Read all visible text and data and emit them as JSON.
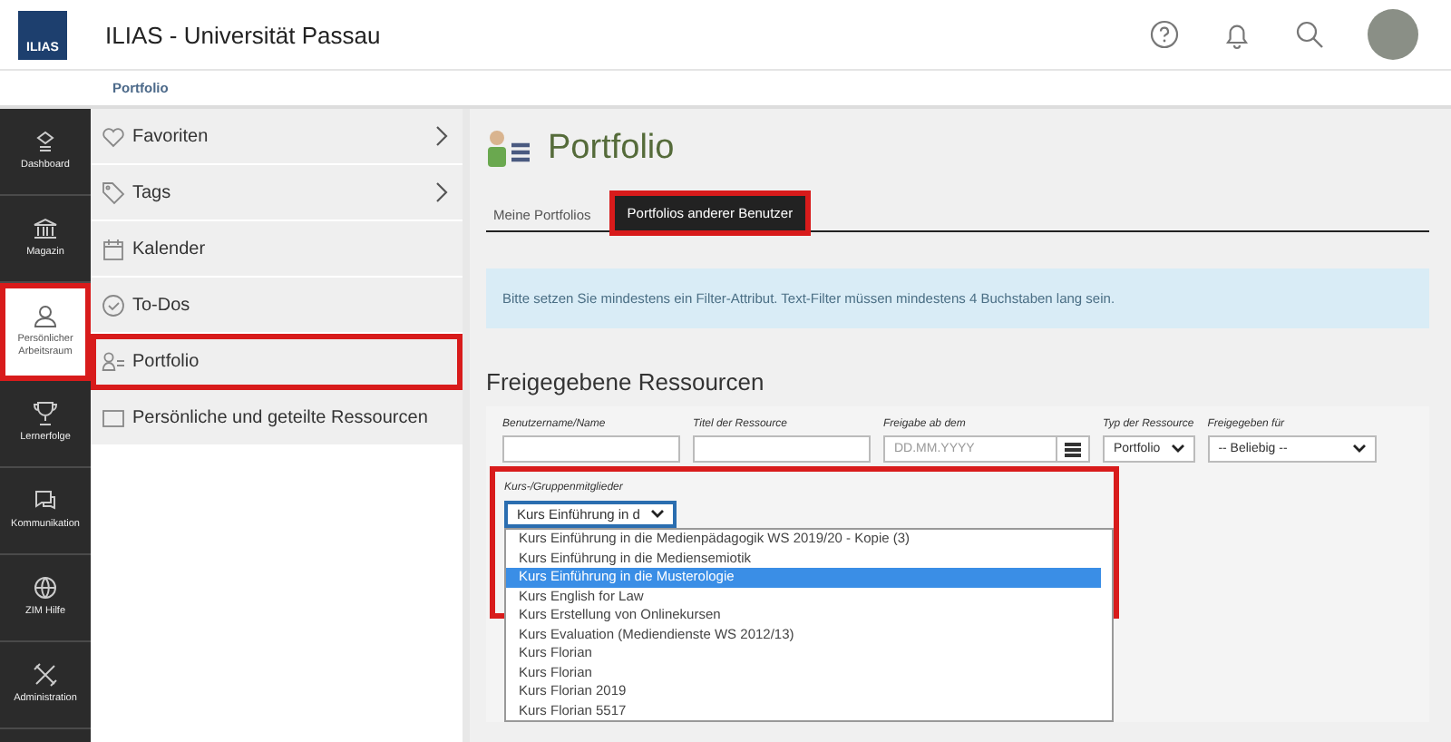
{
  "header": {
    "logo": "ILIAS",
    "title": "ILIAS - Universität Passau"
  },
  "breadcrumb": "Portfolio",
  "rail": [
    {
      "label": "Dashboard",
      "selected": false,
      "highlighted": false
    },
    {
      "label": "Magazin",
      "selected": false,
      "highlighted": false
    },
    {
      "label": "Persönlicher Arbeitsraum",
      "selected": true,
      "highlighted": true
    },
    {
      "label": "Lernerfolge",
      "selected": false,
      "highlighted": false
    },
    {
      "label": "Kommunikation",
      "selected": false,
      "highlighted": false
    },
    {
      "label": "ZIM Hilfe",
      "selected": false,
      "highlighted": false
    },
    {
      "label": "Administration",
      "selected": false,
      "highlighted": false
    }
  ],
  "sidebar": [
    {
      "label": "Favoriten",
      "has_submenu": true,
      "highlighted": false
    },
    {
      "label": "Tags",
      "has_submenu": true,
      "highlighted": false
    },
    {
      "label": "Kalender",
      "has_submenu": false,
      "highlighted": false
    },
    {
      "label": "To-Dos",
      "has_submenu": false,
      "highlighted": false
    },
    {
      "label": "Portfolio",
      "has_submenu": false,
      "highlighted": true
    },
    {
      "label": "Persönliche und geteilte Ressourcen",
      "has_submenu": false,
      "highlighted": false
    }
  ],
  "page_title": "Portfolio",
  "tabs": [
    {
      "label": "Meine Portfolios",
      "selected": false,
      "highlighted": false
    },
    {
      "label": "Portfolios anderer Benutzer",
      "selected": true,
      "highlighted": true
    }
  ],
  "info_message": "Bitte setzen Sie mindestens ein Filter-Attribut. Text-Filter müssen mindestens 4 Buchstaben lang sein.",
  "section_title": "Freigegebene Ressourcen",
  "filters": [
    {
      "label": "Benutzername/Name",
      "kind": "text"
    },
    {
      "label": "Titel der Ressource",
      "kind": "text"
    },
    {
      "label": "Freigabe ab dem",
      "kind": "date",
      "placeholder": "DD.MM.YYYY"
    },
    {
      "label": "Typ der Ressource",
      "kind": "select",
      "value": "Portfolio"
    },
    {
      "label": "Freigegeben für",
      "kind": "select",
      "value": "-- Beliebig --"
    }
  ],
  "course_filter": {
    "label": "Kurs-/Gruppenmitglieder",
    "value": "Kurs Einführung in d",
    "highlighted": true,
    "options": [
      {
        "label": "Kurs Einführung in die Medienpädagogik WS 2019/20 - Kopie (3)",
        "selected": false
      },
      {
        "label": "Kurs Einführung in die Mediensemiotik",
        "selected": false
      },
      {
        "label": "Kurs Einführung in die Musterologie",
        "selected": true
      },
      {
        "label": "Kurs English for Law",
        "selected": false
      },
      {
        "label": "Kurs Erstellung von Onlinekursen",
        "selected": false
      },
      {
        "label": "Kurs Evaluation (Mediendienste WS 2012/13)",
        "selected": false
      },
      {
        "label": "Kurs Florian",
        "selected": false
      },
      {
        "label": "Kurs Florian",
        "selected": false
      },
      {
        "label": "Kurs Florian 2019",
        "selected": false
      },
      {
        "label": "Kurs Florian 5517",
        "selected": false
      }
    ]
  }
}
